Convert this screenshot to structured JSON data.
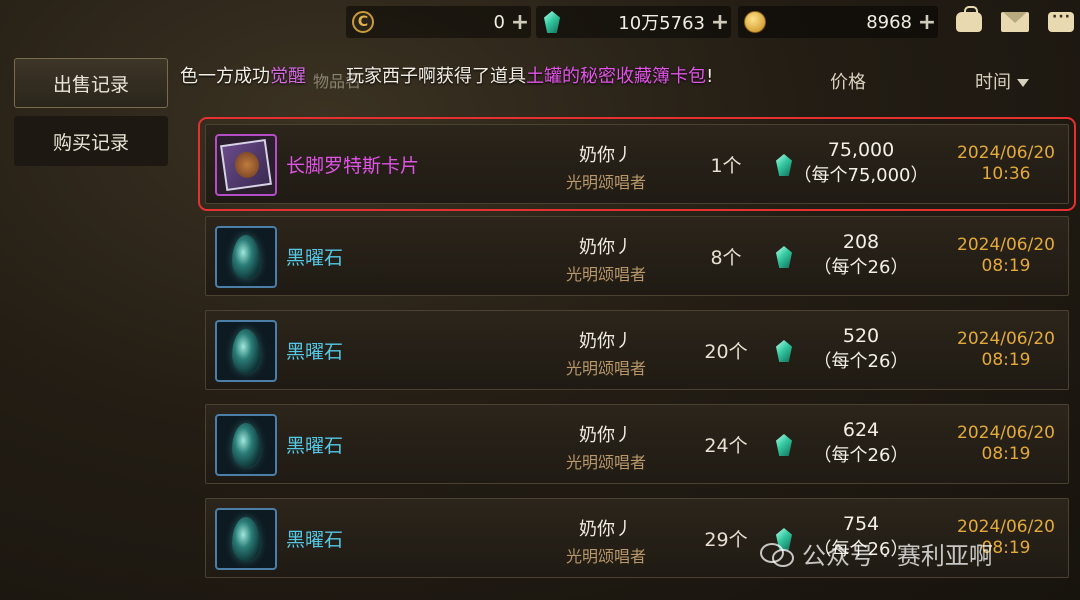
{
  "currency": [
    {
      "icon": "c-coin-icon",
      "amount": "0"
    },
    {
      "icon": "gem-icon",
      "amount": "10万5763"
    },
    {
      "icon": "gold-coin-icon",
      "amount": "8968"
    }
  ],
  "plus": "+",
  "tabs": {
    "sell": "出售记录",
    "buy": "购买记录"
  },
  "marquee": {
    "prefix": "色一方成功",
    "hl1": "觉醒",
    "mid": "玩家西子啊获得了道具",
    "hl2": "土罐的秘密收藏簿卡包",
    "suffix": "!"
  },
  "headers": {
    "item": "物品名",
    "price": "价格",
    "time": "时间"
  },
  "rows": [
    {
      "name": "长脚罗特斯卡片",
      "type": "card",
      "seller": "奶你丿",
      "seller_title": "光明颂唱者",
      "qty": "1个",
      "total": "75,000",
      "each": "（每个75,000）",
      "date": "2024/06/20",
      "time": "10:36"
    },
    {
      "name": "黑曜石",
      "type": "obsidian",
      "seller": "奶你丿",
      "seller_title": "光明颂唱者",
      "qty": "8个",
      "total": "208",
      "each": "（每个26）",
      "date": "2024/06/20",
      "time": "08:19"
    },
    {
      "name": "黑曜石",
      "type": "obsidian",
      "seller": "奶你丿",
      "seller_title": "光明颂唱者",
      "qty": "20个",
      "total": "520",
      "each": "（每个26）",
      "date": "2024/06/20",
      "time": "08:19"
    },
    {
      "name": "黑曜石",
      "type": "obsidian",
      "seller": "奶你丿",
      "seller_title": "光明颂唱者",
      "qty": "24个",
      "total": "624",
      "each": "（每个26）",
      "date": "2024/06/20",
      "time": "08:19"
    },
    {
      "name": "黑曜石",
      "type": "obsidian",
      "seller": "奶你丿",
      "seller_title": "光明颂唱者",
      "qty": "29个",
      "total": "754",
      "each": "（每个26）",
      "date": "2024/06/20",
      "time": "08:19"
    }
  ],
  "watermark": "公众号 · 赛利亚啊",
  "colors": {
    "accent_gold": "#e3a93a",
    "item_blue": "#55c8e6",
    "item_purple": "#e053e6",
    "highlight_red": "#e5312f"
  }
}
